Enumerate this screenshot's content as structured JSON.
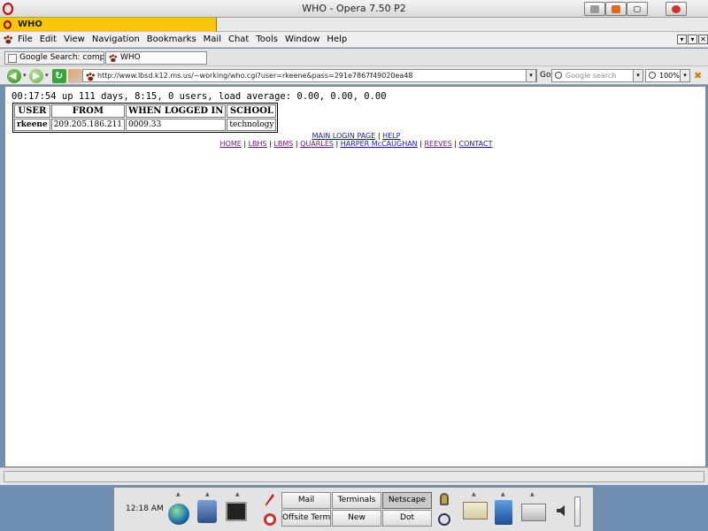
{
  "window": {
    "title": "WHO - Opera 7.50 P2"
  },
  "doc_tab": {
    "label": "WHO"
  },
  "menu": {
    "items": [
      "File",
      "Edit",
      "View",
      "Navigation",
      "Bookmarks",
      "Mail",
      "Chat",
      "Tools",
      "Window",
      "Help"
    ]
  },
  "tabs": [
    {
      "label": "Google Search: comp.c..."
    },
    {
      "label": "WHO"
    }
  ],
  "address": {
    "url": "http://www.lbsd.k12.ms.us/~working/who.cgi?user=rkeene&pass=291e7867f49020ea48",
    "go_label": "Go",
    "search_placeholder": "Google search",
    "zoom": "100%"
  },
  "page": {
    "uptime": "00:17:54 up 111 days,  8:15,  0 users,  load average: 0.00, 0.00, 0.00",
    "table": {
      "headers": [
        "USER",
        "FROM",
        "WHEN LOGGED IN",
        "SCHOOL"
      ],
      "rows": [
        [
          "rkeene",
          "209.205.186.211",
          "0009.33",
          "technology"
        ]
      ]
    },
    "links_row1": [
      "MAIN LOGIN PAGE",
      "HELP"
    ],
    "links_row2": [
      "HOME",
      "LBHS",
      "LBMS",
      "QUARLES",
      "HARPER McCAUGHAN",
      "REEVES",
      "CONTACT"
    ],
    "separator": "|"
  },
  "panel": {
    "clock": "12:18 AM",
    "buttons": [
      "Mail",
      "Terminals",
      "Netscape",
      "Offsite Term",
      "New",
      "Dot"
    ],
    "active_button": "Netscape"
  },
  "colors": {
    "doc_tab": "#f6c70a",
    "link": "#1a1aa8",
    "visited_link": "#6a1a7a",
    "desktop": "#6f8fb3"
  }
}
